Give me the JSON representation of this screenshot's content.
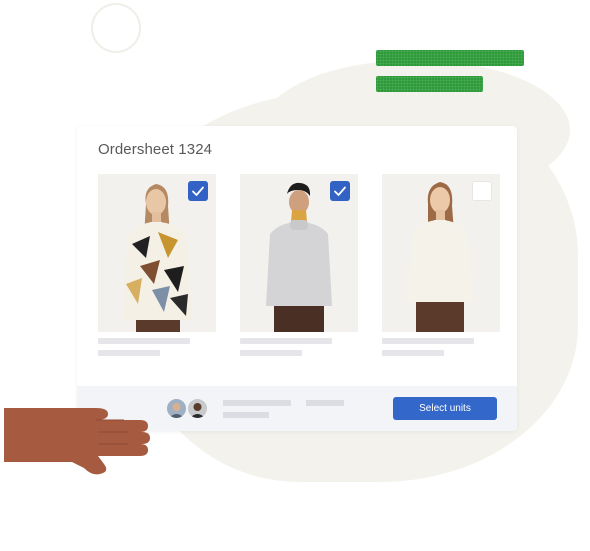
{
  "ordersheet": {
    "title": "Ordersheet 1324",
    "products": [
      {
        "name": "patterned-shirt",
        "checked": true
      },
      {
        "name": "grey-turtleneck",
        "checked": true
      },
      {
        "name": "white-longsleeve",
        "checked": false
      }
    ]
  },
  "footer": {
    "select_label": "Select units"
  },
  "colors": {
    "accent": "#3367c9",
    "green_bar": "#2e9b3a",
    "hand": "#a65a40",
    "background_blob": "#f3f2ec"
  },
  "icons": [
    "check-icon",
    "avatar-icon",
    "hand-illustration"
  ]
}
